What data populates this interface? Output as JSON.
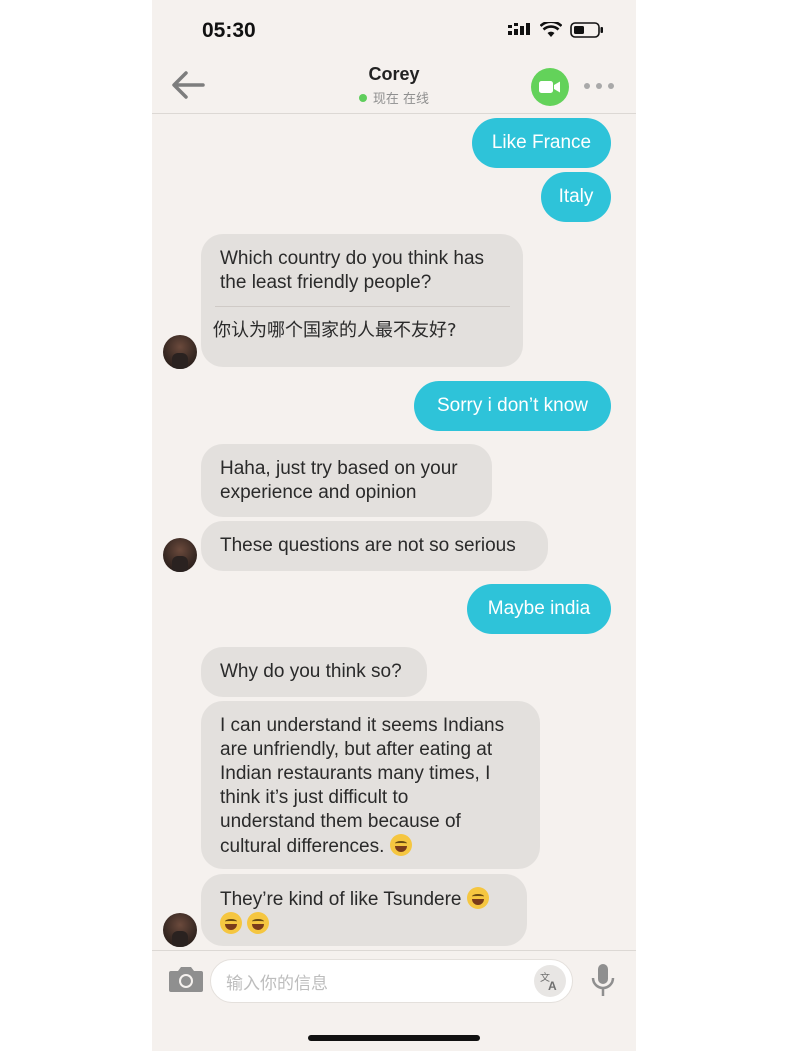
{
  "status_bar": {
    "time": "05:30"
  },
  "header": {
    "contact_name": "Corey",
    "status": "现在 在线"
  },
  "messages": [
    {
      "side": "out",
      "text": "Like France"
    },
    {
      "side": "out",
      "text": "Italy"
    },
    {
      "side": "in",
      "lines": [
        "Which country do you think has",
        "the least friendly people?"
      ],
      "translation": "你认为哪个国家的人最不友好?"
    },
    {
      "side": "out",
      "text": "Sorry i don’t know"
    },
    {
      "side": "in",
      "lines": [
        "Haha, just try based on your",
        "experience and opinion"
      ]
    },
    {
      "side": "in",
      "lines": [
        "These questions are not so serious"
      ]
    },
    {
      "side": "out",
      "text": "Maybe india"
    },
    {
      "side": "in",
      "lines": [
        "Why do you think so?"
      ]
    },
    {
      "side": "in",
      "lines": [
        "I can understand it seems Indians",
        "are unfriendly, but after eating at",
        "Indian restaurants many times, I",
        "think it’s just difficult to",
        "understand them because of",
        "cultural differences."
      ],
      "emoji": [
        "grinning-sweat"
      ]
    },
    {
      "side": "in",
      "lines": [
        "They’re kind of like Tsundere"
      ],
      "emoji": [
        "tears-of-joy",
        "tears-of-joy",
        "tears-of-joy"
      ]
    }
  ],
  "input": {
    "placeholder": "输入你的信息"
  },
  "colors": {
    "outgoing_bubble": "#2ec3d9",
    "incoming_bubble": "#e3e0dd",
    "online": "#5fce5c",
    "video_button": "#63d25a",
    "background": "#f5f1ee"
  },
  "icons": [
    "back-arrow-icon",
    "video-camera-icon",
    "more-icon",
    "camera-icon",
    "translate-icon",
    "microphone-icon",
    "signal-icon",
    "wifi-icon",
    "battery-icon"
  ]
}
